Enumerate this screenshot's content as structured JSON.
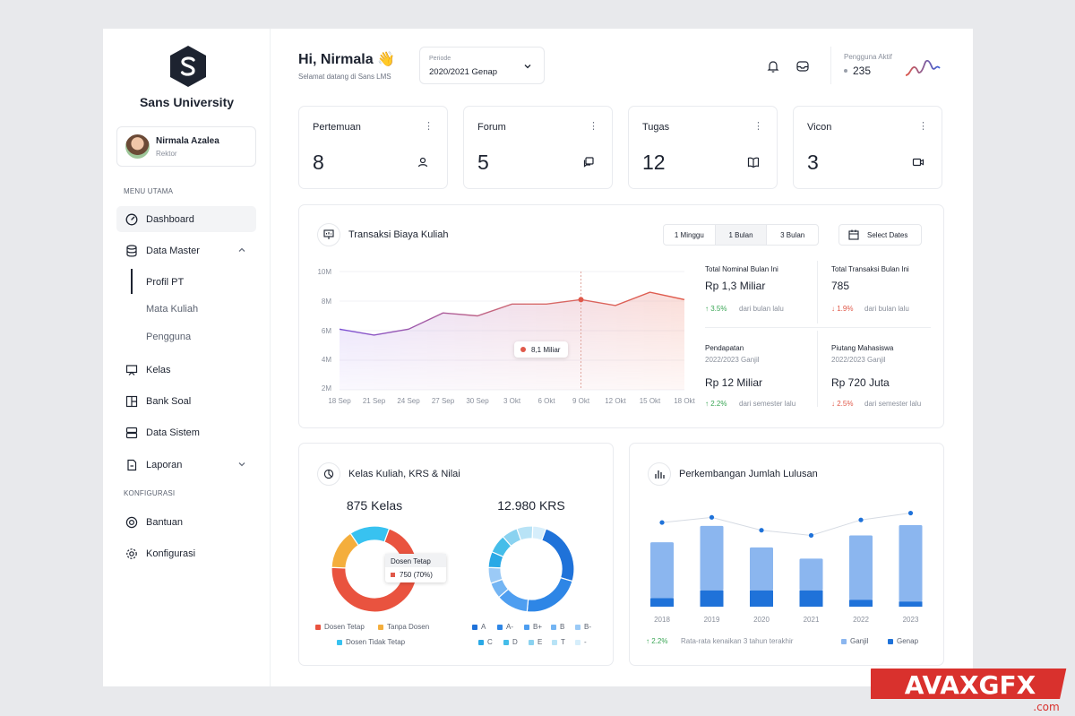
{
  "sidebar": {
    "brand": "Sans University",
    "user": {
      "name": "Nirmala Azalea",
      "role": "Rektor"
    },
    "menu_utama_title": "MENU UTAMA",
    "konfigurasi_title": "KONFIGURASI",
    "items": [
      {
        "label": "Dashboard",
        "icon": "gauge-icon"
      },
      {
        "label": "Data Master",
        "icon": "database-icon"
      },
      {
        "label": "Kelas",
        "icon": "presentation-icon"
      },
      {
        "label": "Bank Soal",
        "icon": "layout-icon"
      },
      {
        "label": "Data Sistem",
        "icon": "server-icon"
      },
      {
        "label": "Laporan",
        "icon": "file-report-icon"
      }
    ],
    "sub_items": [
      "Profil PT",
      "Mata Kuliah",
      "Pengguna"
    ],
    "config_items": [
      {
        "label": "Bantuan",
        "icon": "lifebuoy-icon"
      },
      {
        "label": "Konfigurasi",
        "icon": "gear-icon"
      }
    ]
  },
  "header": {
    "greeting": "Hi, Nirmala 👋",
    "subtitle": "Selamat datang di Sans LMS",
    "periode_label": "Periode",
    "periode_value": "2020/2021 Genap",
    "active_label": "Pengguna Aktif",
    "active_value": "235"
  },
  "stats": [
    {
      "title": "Pertemuan",
      "value": "8",
      "icon": "users-icon"
    },
    {
      "title": "Forum",
      "value": "5",
      "icon": "chat-icon"
    },
    {
      "title": "Tugas",
      "value": "12",
      "icon": "book-icon"
    },
    {
      "title": "Vicon",
      "value": "3",
      "icon": "video-icon"
    }
  ],
  "transaksi": {
    "title": "Transaksi Biaya Kuliah",
    "ranges": [
      "1 Minggu",
      "1 Bulan",
      "3 Bulan"
    ],
    "selected_range": "1 Bulan",
    "select_dates": "Select Dates",
    "tooltip": "8,1 Miliar",
    "kpis": [
      {
        "title": "Total Nominal Bulan Ini",
        "sub": "",
        "value": "Rp 1,3 Miliar",
        "delta": "↑ 3.5%",
        "delta_text": "dari bulan lalu",
        "dir": "up"
      },
      {
        "title": "Total Transaksi Bulan Ini",
        "sub": "",
        "value": "785",
        "delta": "↓ 1.9%",
        "delta_text": "dari bulan lalu",
        "dir": "down"
      },
      {
        "title": "Pendapatan",
        "sub": "2022/2023 Ganjil",
        "value": "Rp 12 Miliar",
        "delta": "↑ 2.2%",
        "delta_text": "dari semester lalu",
        "dir": "up"
      },
      {
        "title": "Piutang Mahasiswa",
        "sub": "2022/2023 Ganjil",
        "value": "Rp 720 Juta",
        "delta": "↓ 2.5%",
        "delta_text": "dari semester lalu",
        "dir": "down"
      }
    ]
  },
  "kelas_krs": {
    "title": "Kelas Kuliah, KRS & Nilai",
    "kelas_label": "875 Kelas",
    "krs_label": "12.980 KRS",
    "tooltip_title": "Dosen Tetap",
    "tooltip_value": "750 (70%)",
    "kelas_legend": [
      "Dosen Tetap",
      "Tanpa Dosen",
      "Dosen Tidak Tetap"
    ],
    "krs_legend": [
      "A",
      "A-",
      "B+",
      "B",
      "B-",
      "C",
      "D",
      "E",
      "T",
      "-"
    ]
  },
  "lulusan": {
    "title": "Perkembangan Jumlah Lulusan",
    "footnote_delta": "↑ 2.2%",
    "footnote_text": "Rata-rata kenaikan 3 tahun terakhir",
    "legend": [
      "Ganjil",
      "Genap"
    ]
  },
  "colors": {
    "accent": "#e0594a",
    "purple": "#7b4fd6",
    "blue": "#1f72d9",
    "lightblue": "#8bb6ef",
    "orange": "#f2a93b",
    "cyan": "#3cc3ef"
  },
  "chart_data": [
    {
      "type": "area",
      "title": "Transaksi Biaya Kuliah",
      "x": [
        "18 Sep",
        "21 Sep",
        "24 Sep",
        "27 Sep",
        "30 Sep",
        "3 Okt",
        "6 Okt",
        "9 Okt",
        "12 Okt",
        "15 Okt",
        "18 Okt"
      ],
      "y": [
        6.1,
        5.7,
        6.1,
        7.2,
        7.0,
        7.8,
        7.8,
        8.1,
        7.7,
        8.6,
        8.1
      ],
      "y_tick_labels": [
        "10M",
        "8M",
        "6M",
        "4M",
        "2M"
      ],
      "ylim": [
        2,
        10
      ],
      "highlight": {
        "x": "9 Okt",
        "y": 8.1,
        "label": "8,1 Miliar"
      }
    },
    {
      "type": "pie",
      "title": "875 Kelas",
      "labels": [
        "Dosen Tetap",
        "Tanpa Dosen",
        "Dosen Tidak Tetap"
      ],
      "values": [
        70,
        15,
        15
      ],
      "colors": [
        "#e9533f",
        "#f4ae3d",
        "#38c2f0"
      ]
    },
    {
      "type": "pie",
      "title": "12.980 KRS",
      "labels": [
        "A",
        "A-",
        "B+",
        "B",
        "B-",
        "C",
        "D",
        "E",
        "T",
        "-"
      ],
      "values": [
        24,
        22,
        12,
        6,
        6,
        6,
        7,
        6,
        6,
        5
      ],
      "colors": [
        "#1f72d9",
        "#2e86e6",
        "#4e9ef0",
        "#74b5f3",
        "#9bcaf6",
        "#2aa9e6",
        "#45bde9",
        "#8ad2f0",
        "#b8e3f6",
        "#d6eefb"
      ]
    },
    {
      "type": "bar",
      "title": "Perkembangan Jumlah Lulusan",
      "categories": [
        "2018",
        "2019",
        "2020",
        "2021",
        "2022",
        "2023"
      ],
      "series": [
        {
          "name": "Ganjil",
          "values": [
            65,
            75,
            50,
            37,
            75,
            89
          ]
        },
        {
          "name": "Genap",
          "values": [
            10,
            19,
            19,
            19,
            8,
            6
          ]
        }
      ],
      "line": [
        98,
        104,
        89,
        83,
        101,
        109
      ],
      "ylim": [
        0,
        120
      ]
    }
  ]
}
